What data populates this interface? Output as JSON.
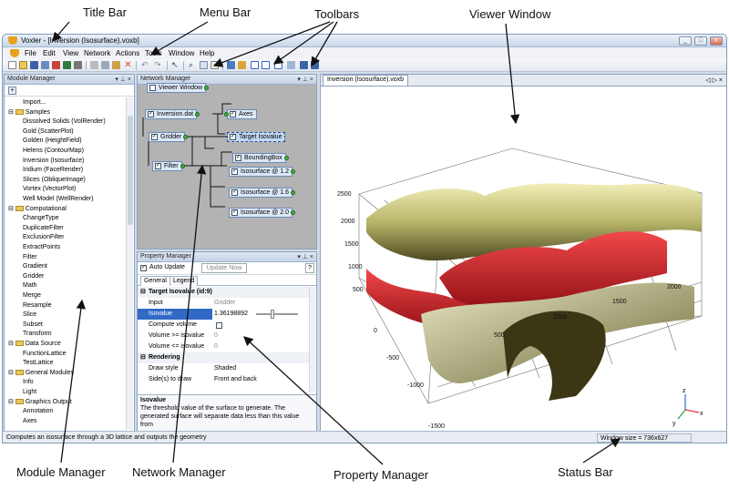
{
  "annotations": {
    "title_bar": "Title Bar",
    "menu_bar": "Menu Bar",
    "toolbars": "Toolbars",
    "viewer_window": "Viewer Window",
    "module_manager": "Module Manager",
    "network_manager": "Network Manager",
    "property_manager": "Property Manager",
    "status_bar": "Status Bar"
  },
  "window": {
    "title": "Voxler - [Inversion (Isosurface).voxb]",
    "controls": [
      "_",
      "□",
      "x"
    ]
  },
  "menu": [
    "File",
    "Edit",
    "View",
    "Network",
    "Actions",
    "Tools",
    "Window",
    "Help"
  ],
  "module_manager": {
    "title": "Module Manager",
    "items": [
      {
        "label": "Import...",
        "level": 1,
        "folder": false
      },
      {
        "label": "Samples",
        "level": 0,
        "folder": true
      },
      {
        "label": "Dissolved Solids (VolRender)",
        "level": 1,
        "folder": false
      },
      {
        "label": "Gold (ScatterPlot)",
        "level": 1,
        "folder": false
      },
      {
        "label": "Golden (HeightField)",
        "level": 1,
        "folder": false
      },
      {
        "label": "Helens (ContourMap)",
        "level": 1,
        "folder": false
      },
      {
        "label": "Inversion (Isosurface)",
        "level": 1,
        "folder": false
      },
      {
        "label": "Iridium (FaceRender)",
        "level": 1,
        "folder": false
      },
      {
        "label": "Slices (ObliqueImage)",
        "level": 1,
        "folder": false
      },
      {
        "label": "Vortex (VectorPlot)",
        "level": 1,
        "folder": false
      },
      {
        "label": "Well Model (WellRender)",
        "level": 1,
        "folder": false
      },
      {
        "label": "Computational",
        "level": 0,
        "folder": true
      },
      {
        "label": "ChangeType",
        "level": 1,
        "folder": false
      },
      {
        "label": "DuplicateFilter",
        "level": 1,
        "folder": false
      },
      {
        "label": "ExclusionFilter",
        "level": 1,
        "folder": false
      },
      {
        "label": "ExtractPoints",
        "level": 1,
        "folder": false
      },
      {
        "label": "Filter",
        "level": 1,
        "folder": false
      },
      {
        "label": "Gradient",
        "level": 1,
        "folder": false
      },
      {
        "label": "Gridder",
        "level": 1,
        "folder": false
      },
      {
        "label": "Math",
        "level": 1,
        "folder": false
      },
      {
        "label": "Merge",
        "level": 1,
        "folder": false
      },
      {
        "label": "Resample",
        "level": 1,
        "folder": false
      },
      {
        "label": "Slice",
        "level": 1,
        "folder": false
      },
      {
        "label": "Subset",
        "level": 1,
        "folder": false
      },
      {
        "label": "Transform",
        "level": 1,
        "folder": false
      },
      {
        "label": "Data Source",
        "level": 0,
        "folder": true
      },
      {
        "label": "FunctionLattice",
        "level": 1,
        "folder": false
      },
      {
        "label": "TestLattice",
        "level": 1,
        "folder": false
      },
      {
        "label": "General Modules",
        "level": 0,
        "folder": true
      },
      {
        "label": "Info",
        "level": 1,
        "folder": false
      },
      {
        "label": "Light",
        "level": 1,
        "folder": false
      },
      {
        "label": "Graphics Output",
        "level": 0,
        "folder": true
      },
      {
        "label": "Annotation",
        "level": 1,
        "folder": false
      },
      {
        "label": "Axes",
        "level": 1,
        "folder": false
      }
    ]
  },
  "network_manager": {
    "title": "Network Manager",
    "nodes": {
      "viewer": "Viewer Window",
      "inversion": "Inversion.dat",
      "axes": "Axes",
      "gridder": "Gridder",
      "target": "Target Isovalue",
      "bbox": "BoundingBox",
      "filter": "Filter",
      "iso1": "Isosurface @ 1.2",
      "iso2": "Isosurface @ 1.6",
      "iso3": "Isosurface @ 2.0"
    }
  },
  "property_manager": {
    "title": "Property Manager",
    "auto_update": "Auto Update",
    "update_now": "Update Now",
    "help": "?",
    "tabs": [
      "General",
      "Legend"
    ],
    "section1": "Target Isovalue (id:9)",
    "input_label": "Input",
    "input_value": "Gridder",
    "isovalue_label": "Isovalue",
    "isovalue_value": "1.36198892",
    "compute_volume": "Compute volume",
    "vol_ge": "Volume >= isovalue",
    "vol_ge_value": "0",
    "vol_le": "Volume <= isovalue",
    "vol_le_value": "0",
    "section2": "Rendering",
    "draw_style_label": "Draw style",
    "draw_style_value": "Shaded",
    "sides_label": "Side(s) to draw",
    "sides_value": "Front and back",
    "desc_title": "Isovalue",
    "desc_text": "The threshold value of the surface to generate. The generated surface will separate data less than this value from"
  },
  "viewer": {
    "tab": "Inversion (Isosurface).voxb",
    "nav": "◁ ▷ ×",
    "axis_labels": [
      "2500",
      "2000",
      "1500",
      "1000",
      "500",
      "-1500",
      "-1000",
      "-500",
      "0",
      "500",
      "1000",
      "1500",
      "2000"
    ],
    "axis_x": "x",
    "axis_y": "y",
    "axis_z": "z"
  },
  "status": {
    "left": "Computes an isosurface through a 3D lattice and outputs the geometry",
    "right": "Window size = 736x627"
  }
}
